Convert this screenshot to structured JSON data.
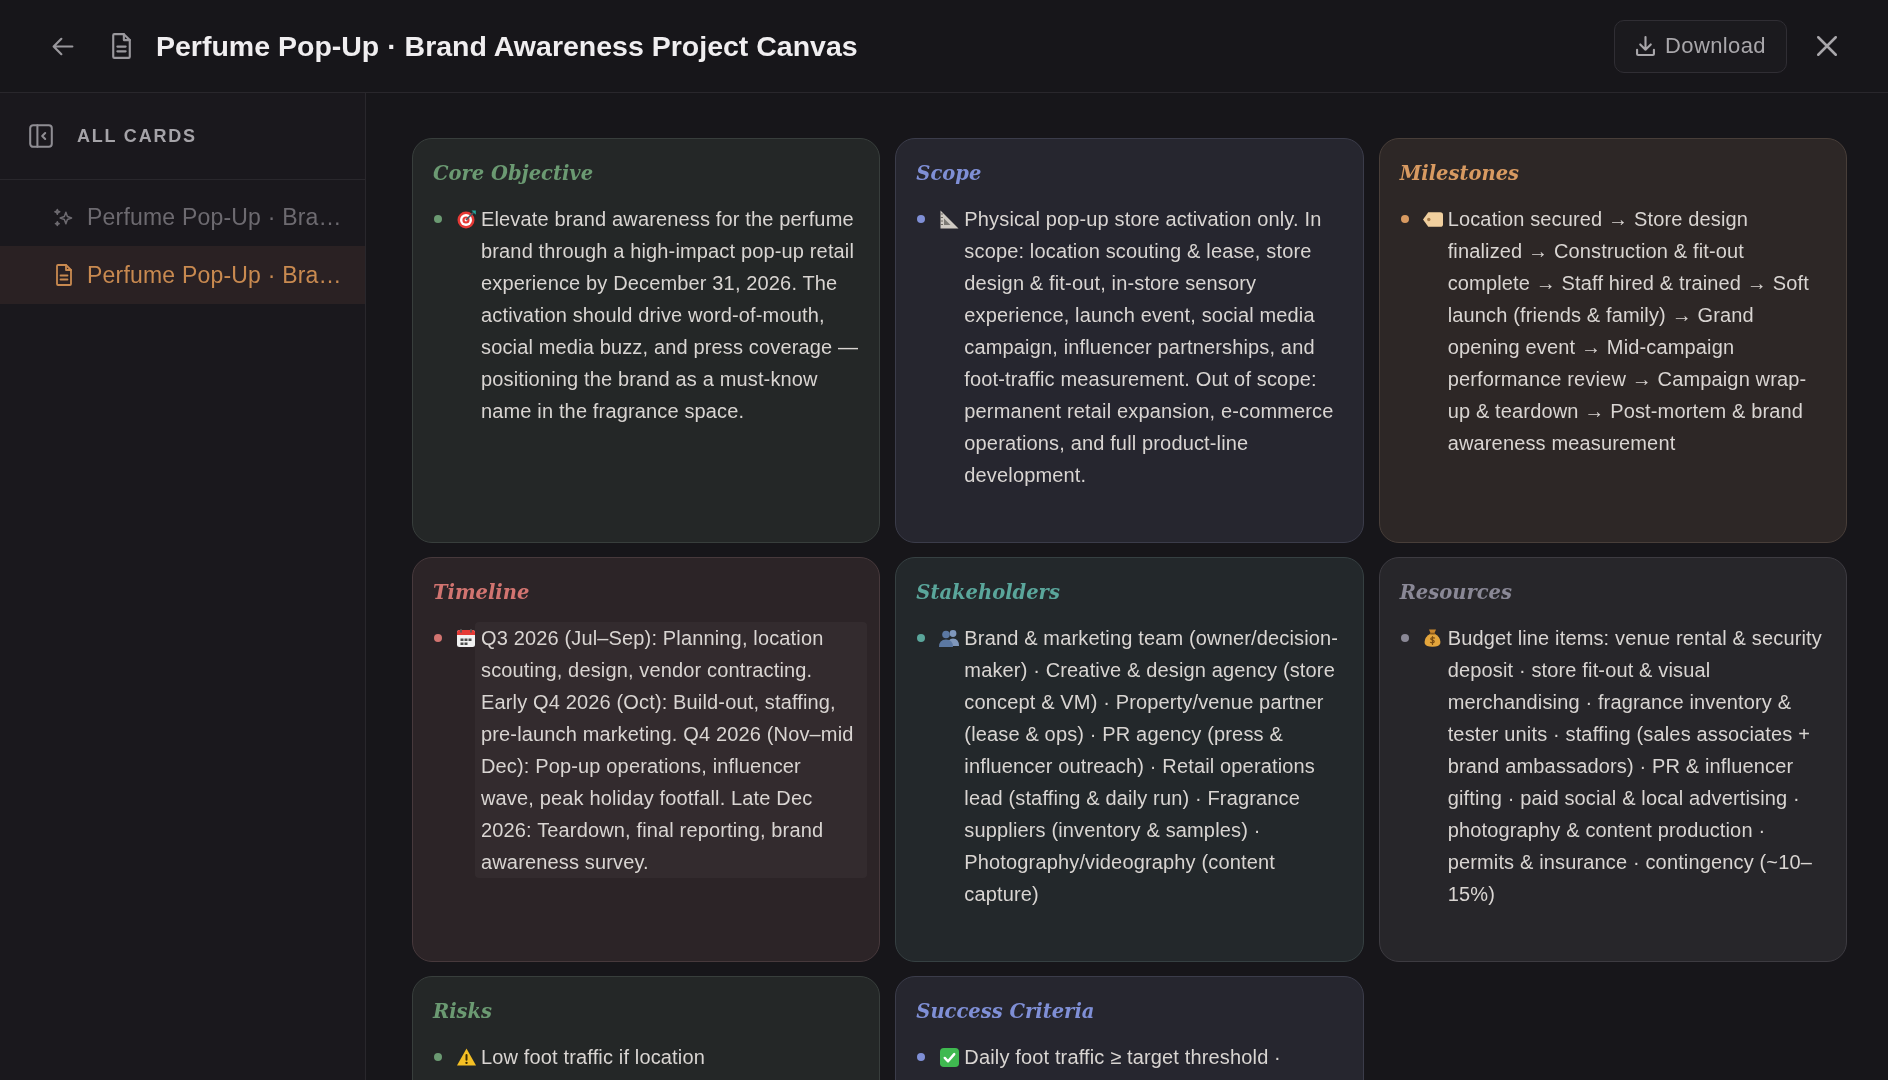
{
  "header": {
    "title": "Perfume Pop-Up · Brand Awareness Project Canvas",
    "download_button": {
      "label": "Download"
    }
  },
  "sidebar": {
    "heading": "ALL CARDS",
    "items": [
      {
        "label": "Perfume Pop-Up · Bra…",
        "kind": "generated",
        "selected": false
      },
      {
        "label": "Perfume Pop-Up · Bra…",
        "kind": "document",
        "selected": true
      }
    ]
  },
  "cards": [
    {
      "title": "Core Objective",
      "color": "#6b9a72",
      "items": [
        {
          "text": "Elevate brand awareness for the perfume brand through a high-impact pop-up retail experience by December 31, 2026. The activation should drive word-of-mouth, social media buzz, and press coverage — positioning the brand as a must-know name in the fragrance space.",
          "hovered": false
        }
      ]
    },
    {
      "title": "Scope",
      "color": "#7f8fd6",
      "items": [
        {
          "text": "Physical pop-up store activation only. In scope: location scouting & lease, store design & fit-out, in-store sensory experience, launch event, social media campaign, influencer partnerships, and foot-traffic measurement. Out of scope: permanent retail expansion, e-commerce operations, and full product-line development.",
          "hovered": false
        }
      ]
    },
    {
      "title": "Milestones",
      "color": "#d89a61",
      "items": [
        {
          "text": "Location secured → Store design finalized → Construction & fit-out complete → Staff hired & trained → Soft launch (friends & family) → Grand opening event → Mid-campaign performance review → Campaign wrap-up & teardown → Post-mortem & brand awareness measurement",
          "hovered": false
        }
      ]
    },
    {
      "title": "Timeline",
      "color": "#d27470",
      "items": [
        {
          "text": "Q3 2026 (Jul–Sep): Planning, location scouting, design, vendor contracting. Early Q4 2026 (Oct): Build-out, staffing, pre-launch marketing. Q4 2026 (Nov–mid Dec): Pop-up operations, influencer wave, peak holiday footfall. Late Dec 2026: Teardown, final reporting, brand awareness survey.",
          "hovered": true
        }
      ]
    },
    {
      "title": "Stakeholders",
      "color": "#5aa69b",
      "items": [
        {
          "text": "Brand & marketing team (owner/decision-maker) · Creative & design agency (store concept & VM) · Property/venue partner (lease & ops) · PR agency (press & influencer outreach) · Retail operations lead (staffing & daily run) · Fragrance suppliers (inventory & samples) · Photography/videography (content capture)",
          "hovered": false
        }
      ]
    },
    {
      "title": "Resources",
      "color": "#8a8896",
      "items": [
        {
          "text": "Budget line items: venue rental & security deposit · store fit-out & visual merchandising · fragrance inventory & tester units · staffing (sales associates + brand ambassadors) · PR & influencer gifting · paid social & local advertising · photography & content production · permits & insurance · contingency (~10–15%)",
          "hovered": false
        }
      ]
    },
    {
      "title": "Risks",
      "color": "#6b9a72",
      "items": [
        {
          "text": "Low foot traffic if location",
          "hovered": false
        }
      ]
    },
    {
      "title": "Success Criteria",
      "color": "#7f8fd6",
      "items": [
        {
          "text": "Daily foot traffic ≥ target threshold ·",
          "hovered": false
        }
      ]
    }
  ]
}
